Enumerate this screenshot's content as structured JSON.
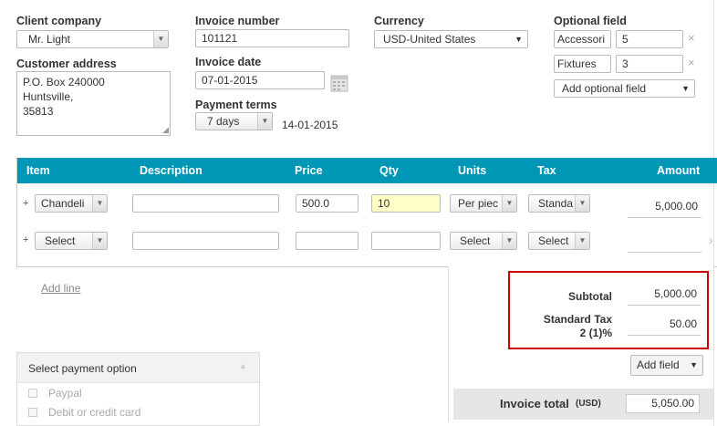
{
  "header": {
    "client_company_label": "Client company",
    "client_company_value": "Mr. Light",
    "customer_address_label": "Customer address",
    "customer_address_lines": [
      "P.O. Box 240000",
      "Huntsville,",
      "35813"
    ],
    "invoice_number_label": "Invoice number",
    "invoice_number_value": "101121",
    "invoice_date_label": "Invoice date",
    "invoice_date_value": "07-01-2015",
    "payment_terms_label": "Payment terms",
    "payment_terms_value": "7 days",
    "due_date": "14-01-2015",
    "currency_label": "Currency",
    "currency_value": "USD-United States",
    "optional_field_label": "Optional field",
    "optional_fields": [
      {
        "name": "Accessori",
        "value": "5"
      },
      {
        "name": "Fixtures",
        "value": "3"
      }
    ],
    "add_optional_field": "Add optional field"
  },
  "table": {
    "columns": [
      "Item",
      "Description",
      "Price",
      "Qty",
      "Units",
      "Tax",
      "Amount"
    ],
    "header_color": "#0097b7",
    "rows": [
      {
        "item": "Chandeli",
        "description": "",
        "price": "500.0",
        "qty": "10",
        "units": "Per piec",
        "tax": "Standa",
        "amount": "5,000.00"
      },
      {
        "item": "Select",
        "description": "",
        "price": "",
        "qty": "",
        "units": "Select",
        "tax": "Select",
        "amount": ""
      }
    ],
    "add_line": "Add line"
  },
  "totals": {
    "subtotal_label": "Subtotal",
    "subtotal_value": "5,000.00",
    "tax_label_line1": "Standard Tax",
    "tax_label_line2": "2 (1)%",
    "tax_value": "50.00",
    "add_field": "Add field",
    "invoice_total_label": "Invoice total",
    "invoice_total_currency": "(USD)",
    "invoice_total_value": "5,050.00",
    "highlight_color": "#cc0000"
  },
  "payment": {
    "title": "Select payment option",
    "options": [
      "Paypal",
      "Debit or credit card"
    ]
  },
  "icons": {
    "plus": "+",
    "remove": "×",
    "arrow": "▼",
    "collapse": "▲",
    "scroll_right": "›"
  }
}
